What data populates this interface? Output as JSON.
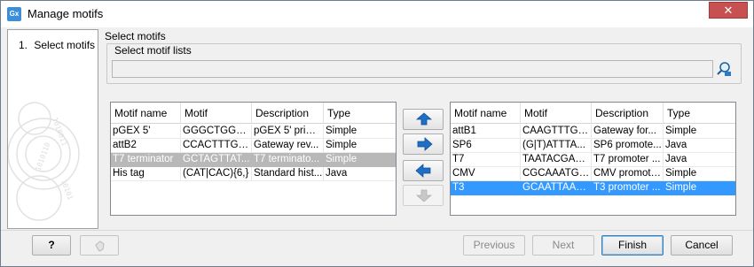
{
  "window": {
    "title": "Manage motifs",
    "app_icon": "Gx",
    "close_label": "✕"
  },
  "steps": [
    {
      "number": "1.",
      "label": "Select motifs"
    }
  ],
  "content": {
    "title": "Select motifs",
    "motif_lists_label": "Select motif lists",
    "motif_lists_value": ""
  },
  "table_headers": [
    "Motif name",
    "Motif",
    "Description",
    "Type"
  ],
  "left_table": {
    "rows": [
      {
        "name": "pGEX 5'",
        "motif": "GGGCTGGCA...",
        "description": "pGEX 5' primer",
        "type": "Simple",
        "state": ""
      },
      {
        "name": "attB2",
        "motif": "CCACTTTGT...",
        "description": "Gateway rev...",
        "type": "Simple",
        "state": ""
      },
      {
        "name": "T7 terminator",
        "motif": "GCTAGTTAT...",
        "description": "T7 terminato...",
        "type": "Simple",
        "state": "selected-inactive"
      },
      {
        "name": "His tag",
        "motif": "(CAT|CAC){6,}",
        "description": "Standard hist...",
        "type": "Java",
        "state": ""
      }
    ]
  },
  "right_table": {
    "rows": [
      {
        "name": "attB1",
        "motif": "CAAGTTTGT...",
        "description": "Gateway for...",
        "type": "Simple",
        "state": ""
      },
      {
        "name": "SP6",
        "motif": "(G|T)ATTTA...",
        "description": "SP6 promote...",
        "type": "Java",
        "state": ""
      },
      {
        "name": "T7",
        "motif": "TAATACGAC...",
        "description": "T7 promoter ...",
        "type": "Java",
        "state": ""
      },
      {
        "name": "CMV",
        "motif": "CGCAAATGG...",
        "description": "CMV promote...",
        "type": "Simple",
        "state": ""
      },
      {
        "name": "T3",
        "motif": "GCAATTAAC...",
        "description": "T3 promoter ...",
        "type": "Simple",
        "state": "selected"
      }
    ]
  },
  "move_buttons": [
    {
      "name": "move-up-button",
      "icon": "arrow-up-icon",
      "enabled": true
    },
    {
      "name": "add-right-button",
      "icon": "arrow-right-icon",
      "enabled": true
    },
    {
      "name": "remove-left-button",
      "icon": "arrow-left-icon",
      "enabled": true
    },
    {
      "name": "move-down-button",
      "icon": "arrow-down-icon",
      "enabled": false
    }
  ],
  "footer": {
    "help_label": "?",
    "previous_label": "Previous",
    "next_label": "Next",
    "finish_label": "Finish",
    "cancel_label": "Cancel"
  },
  "colors": {
    "selection_blue": "#3399ff",
    "selection_grey": "#b8b8b8",
    "arrow_blue": "#1f6fc5",
    "close_red": "#c75050"
  }
}
